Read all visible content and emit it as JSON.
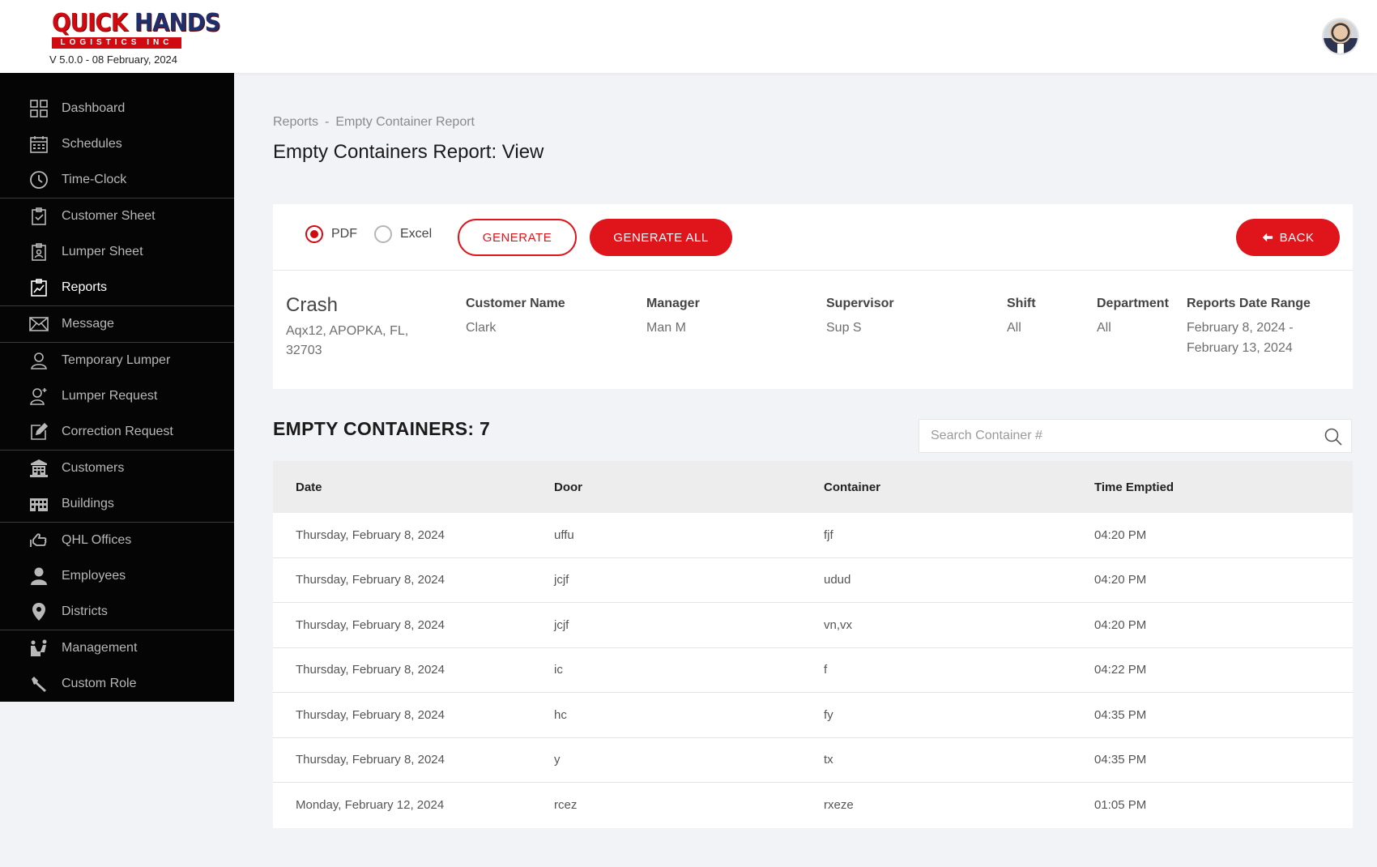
{
  "header": {
    "logo_top": "QUICK",
    "logo_top2": "HANDS",
    "logo_sub": "LOGISTICS INC",
    "version": "V 5.0.0 - 08 February, 2024"
  },
  "sidebar": {
    "groups": [
      [
        {
          "label": "Dashboard",
          "icon": "dashboard-icon"
        },
        {
          "label": "Schedules",
          "icon": "calendar-icon"
        },
        {
          "label": "Time-Clock",
          "icon": "clock-icon"
        }
      ],
      [
        {
          "label": "Customer Sheet",
          "icon": "clipboard-check-icon"
        },
        {
          "label": "Lumper Sheet",
          "icon": "clipboard-user-icon"
        },
        {
          "label": "Reports",
          "icon": "report-chart-icon",
          "active": true
        }
      ],
      [
        {
          "label": "Message",
          "icon": "envelope-icon"
        }
      ],
      [
        {
          "label": "Temporary Lumper",
          "icon": "user-outline-icon"
        },
        {
          "label": "Lumper Request",
          "icon": "user-plus-icon"
        },
        {
          "label": "Correction Request",
          "icon": "edit-icon"
        }
      ],
      [
        {
          "label": "Customers",
          "icon": "building-icon"
        },
        {
          "label": "Buildings",
          "icon": "buildings-icon"
        }
      ],
      [
        {
          "label": "QHL Offices",
          "icon": "hand-icon"
        },
        {
          "label": "Employees",
          "icon": "person-icon"
        },
        {
          "label": "Districts",
          "icon": "map-pin-icon"
        }
      ],
      [
        {
          "label": "Management",
          "icon": "management-icon"
        },
        {
          "label": "Custom Role",
          "icon": "wrench-icon"
        }
      ]
    ]
  },
  "breadcrumb": {
    "parent": "Reports",
    "separator": "-",
    "current": "Empty Container Report"
  },
  "page_title": "Empty Containers Report: View",
  "toolbar": {
    "pdf_label": "PDF",
    "excel_label": "Excel",
    "selected_format": "PDF",
    "generate_label": "GENERATE",
    "generate_all_label": "GENERATE ALL",
    "back_label": "BACK"
  },
  "info": {
    "customer_title": "Crash",
    "customer_address": "Aqx12, APOPKA, FL, 32703",
    "customer_name_label": "Customer Name",
    "customer_name": "Clark",
    "manager_label": "Manager",
    "manager": "Man M",
    "supervisor_label": "Supervisor",
    "supervisor": "Sup S",
    "shift_label": "Shift",
    "shift": "All",
    "department_label": "Department",
    "department": "All",
    "date_range_label": "Reports Date Range",
    "date_range": "February 8, 2024 - February 13, 2024"
  },
  "containers": {
    "title": "EMPTY CONTAINERS: 7",
    "search_placeholder": "Search Container #",
    "columns": [
      "Date",
      "Door",
      "Container",
      "Time Emptied"
    ],
    "rows": [
      [
        "Thursday, February 8, 2024",
        "uffu",
        "fjf",
        "04:20 PM"
      ],
      [
        "Thursday, February 8, 2024",
        "jcjf",
        "udud",
        "04:20 PM"
      ],
      [
        "Thursday, February 8, 2024",
        "jcjf",
        "vn,vx",
        "04:20 PM"
      ],
      [
        "Thursday, February 8, 2024",
        "ic",
        "f",
        "04:22 PM"
      ],
      [
        "Thursday, February 8, 2024",
        "hc",
        "fy",
        "04:35 PM"
      ],
      [
        "Thursday, February 8, 2024",
        "y",
        "tx",
        "04:35 PM"
      ],
      [
        "Monday, February 12, 2024",
        "rcez",
        "rxeze",
        "01:05 PM"
      ]
    ]
  },
  "colors": {
    "accent": "#e0141b",
    "sidebar_bg": "#050505",
    "page_bg": "#f2f3f7"
  }
}
